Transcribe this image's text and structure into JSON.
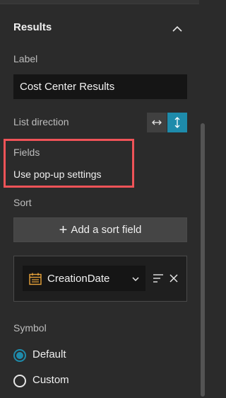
{
  "section": {
    "title": "Results",
    "collapse_icon": "chevron-up-icon"
  },
  "label_field": {
    "label": "Label",
    "value": "Cost Center Results"
  },
  "list_direction": {
    "label": "List direction",
    "horizontal_icon": "arrows-horizontal-icon",
    "vertical_icon": "arrows-vertical-icon",
    "selected": "vertical"
  },
  "fields": {
    "label": "Fields",
    "value": "Use pop-up settings"
  },
  "sort": {
    "label": "Sort",
    "add_button_label": "Add a sort field",
    "items": [
      {
        "field": "CreationDate",
        "field_icon": "calendar-icon"
      }
    ]
  },
  "symbol": {
    "label": "Symbol",
    "options": [
      {
        "label": "Default",
        "selected": true
      },
      {
        "label": "Custom",
        "selected": false
      }
    ]
  },
  "colors": {
    "accent": "#1e8bab",
    "highlight": "#ef5358",
    "calendar_icon": "#e8a33a"
  }
}
